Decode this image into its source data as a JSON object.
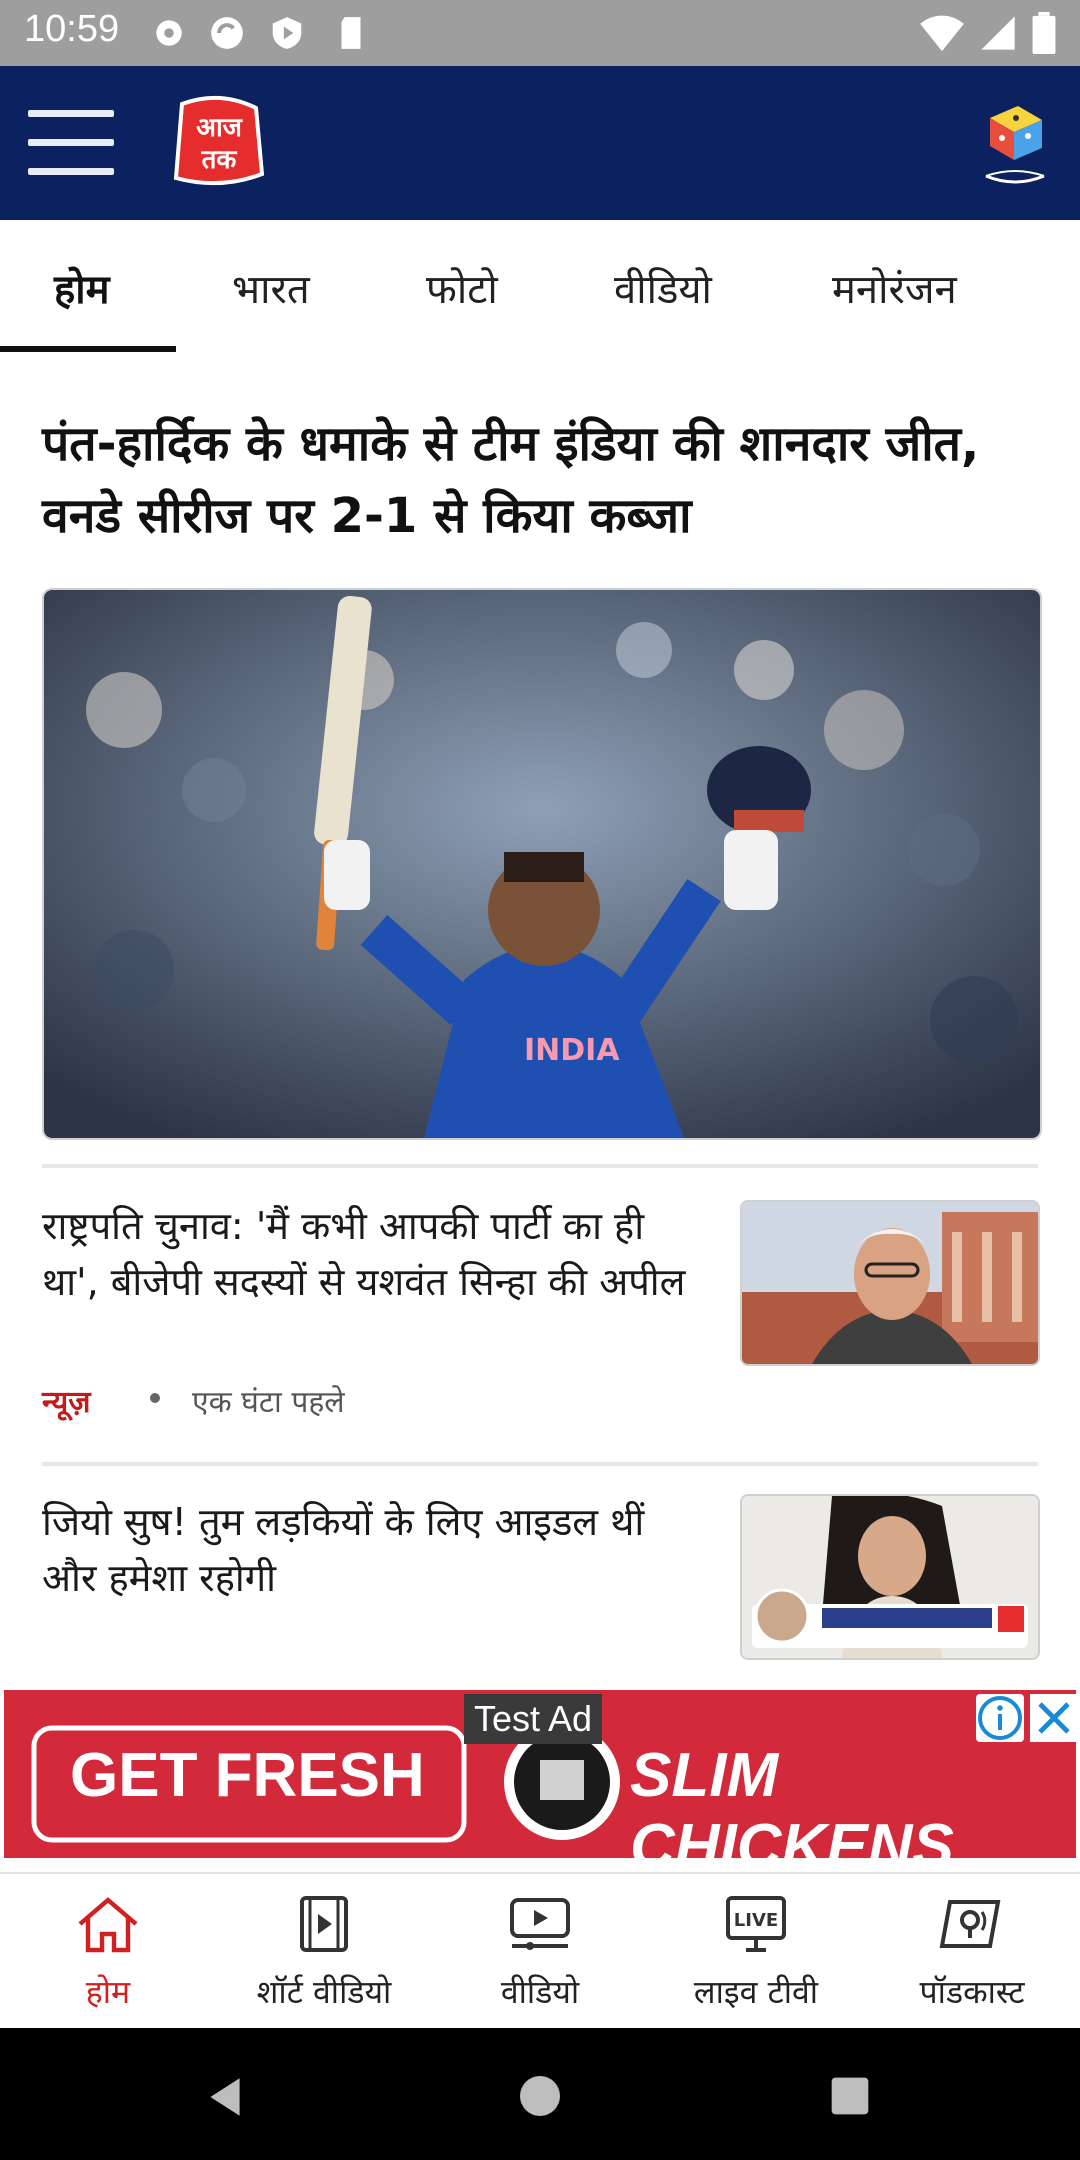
{
  "status_bar": {
    "time": "10:59"
  },
  "header": {
    "logo_text": "आज तक"
  },
  "tabs": [
    {
      "label": "होम"
    },
    {
      "label": "भारत"
    },
    {
      "label": "फोटो"
    },
    {
      "label": "वीडियो"
    },
    {
      "label": "मनोरंजन"
    }
  ],
  "lead_story": {
    "title": "पंत-हार्दिक के धमाके से टीम इंडिया की शानदार जीत, वनडे सीरीज पर 2-1 से किया कब्जा"
  },
  "stories": [
    {
      "title": "राष्ट्रपति चुनाव: 'मैं कभी आपकी पार्टी का ही था', बीजेपी सदस्यों से यशवंत सिन्हा की अपील",
      "category": "न्यूज़",
      "time": "एक घंटा पहले"
    },
    {
      "title": "जियो सुष! तुम लड़कियों के लिए आइडल थीं और हमेशा रहोगी"
    }
  ],
  "ad": {
    "label": "Test Ad",
    "left_text": "GET FRESH",
    "right_text": "SLIM CHICKENS"
  },
  "bottom_nav": [
    {
      "label": "होम",
      "icon": "home-icon"
    },
    {
      "label": "शॉर्ट वीडियो",
      "icon": "short-video-icon"
    },
    {
      "label": "वीडियो",
      "icon": "video-icon"
    },
    {
      "label": "लाइव टीवी",
      "icon": "live-tv-icon"
    },
    {
      "label": "पॉडकास्ट",
      "icon": "podcast-icon"
    }
  ],
  "colors": {
    "header_bg": "#0c2260",
    "accent_red": "#d0201f"
  }
}
